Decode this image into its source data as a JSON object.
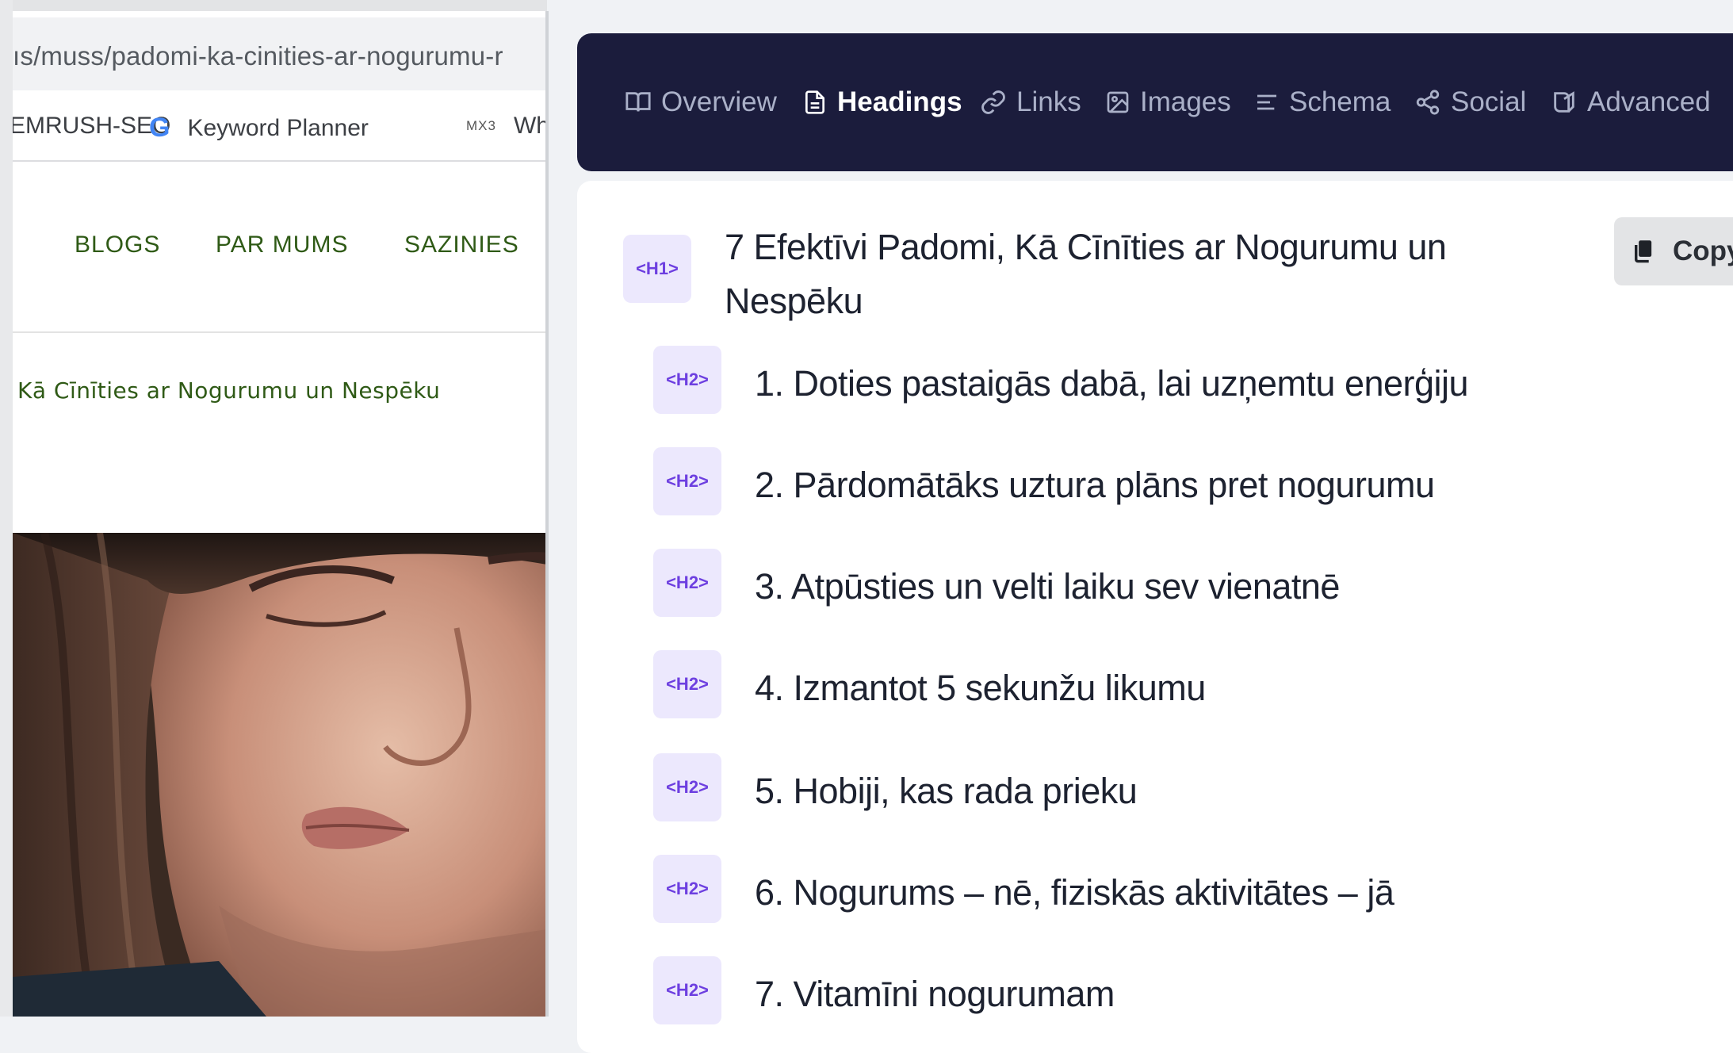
{
  "browser": {
    "url": "ıs/muss/padomi-ka-cinities-ar-nogurumu-r",
    "bookmarks": [
      {
        "label": "EMRUSH-SEO",
        "icon": "semrush-icon"
      },
      {
        "label": "Keyword Planner",
        "icon": "google-icon",
        "icon_glyph": "G"
      },
      {
        "label": "Wh",
        "icon": "mx3-icon",
        "icon_glyph": "MX3"
      }
    ],
    "site_nav": [
      "BLOGS",
      "PAR MUMS",
      "SAZINIES"
    ],
    "breadcrumb": "Kā Cīnīties ar Nogurumu un Nespēku"
  },
  "extension": {
    "tabs": [
      {
        "label": "Overview",
        "icon": "book-icon"
      },
      {
        "label": "Headings",
        "icon": "document-icon",
        "active": true
      },
      {
        "label": "Links",
        "icon": "link-icon"
      },
      {
        "label": "Images",
        "icon": "image-icon"
      },
      {
        "label": "Schema",
        "icon": "schema-icon"
      },
      {
        "label": "Social",
        "icon": "share-icon"
      },
      {
        "label": "Advanced",
        "icon": "advanced-icon"
      }
    ],
    "copy_label": "Copy",
    "headings": [
      {
        "tag": "<H1>",
        "text": "7 Efektīvi Padomi, Kā Cīnīties ar Nogurumu un Nespēku"
      },
      {
        "tag": "<H2>",
        "text": "1. Doties pastaigās dabā, lai uzņemtu enerģiju"
      },
      {
        "tag": "<H2>",
        "text": "2. Pārdomātāks uztura plāns pret nogurumu"
      },
      {
        "tag": "<H2>",
        "text": "3. Atpūsties un velti laiku sev vienatnē"
      },
      {
        "tag": "<H2>",
        "text": "4. Izmantot 5 sekunžu likumu"
      },
      {
        "tag": "<H2>",
        "text": "5. Hobiji, kas rada prieku"
      },
      {
        "tag": "<H2>",
        "text": "6. Nogurums – nē, fiziskās aktivitātes – jā"
      },
      {
        "tag": "<H2>",
        "text": "7. Vitamīni nogurumam"
      }
    ]
  },
  "colors": {
    "tabbar_bg": "#1b1c3c",
    "tag_bg": "#ece8fd",
    "tag_text": "#6d3fe0",
    "site_green": "#2f5a16"
  }
}
